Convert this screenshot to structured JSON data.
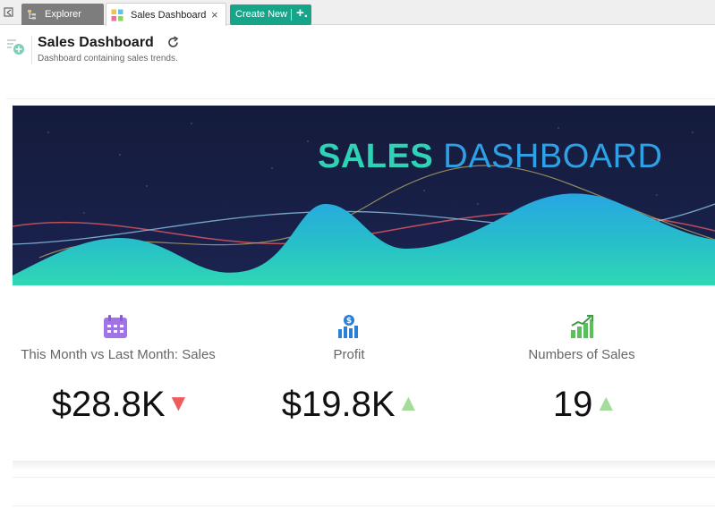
{
  "tabs": {
    "explorer_label": "Explorer",
    "sales_label": "Sales Dashboard",
    "close_glyph": "×",
    "create_label": "Create New",
    "create_plus": "+."
  },
  "header": {
    "title": "Sales Dashboard",
    "description": "Dashboard containing sales trends."
  },
  "banner": {
    "word1": "SALES",
    "word2": "DASHBOARD"
  },
  "kpis": [
    {
      "label": "This Month vs Last Month: Sales",
      "value": "$28.8K",
      "trend": "down",
      "icon": "calendar-icon"
    },
    {
      "label": "Profit",
      "value": "$19.8K",
      "trend": "up",
      "icon": "money-bars-icon"
    },
    {
      "label": "Numbers of Sales",
      "value": "19",
      "trend": "up",
      "icon": "growth-chart-icon"
    }
  ],
  "colors": {
    "accent_green": "#17a589",
    "banner_bg": "#131a3a",
    "trend_down": "#ee5b5b",
    "trend_up": "#a4dc9a",
    "icon_purple": "#a173e6",
    "icon_blue": "#2a7fd8",
    "icon_green": "#59c15c"
  },
  "arrows": {
    "down": "▼",
    "up": "▲"
  }
}
